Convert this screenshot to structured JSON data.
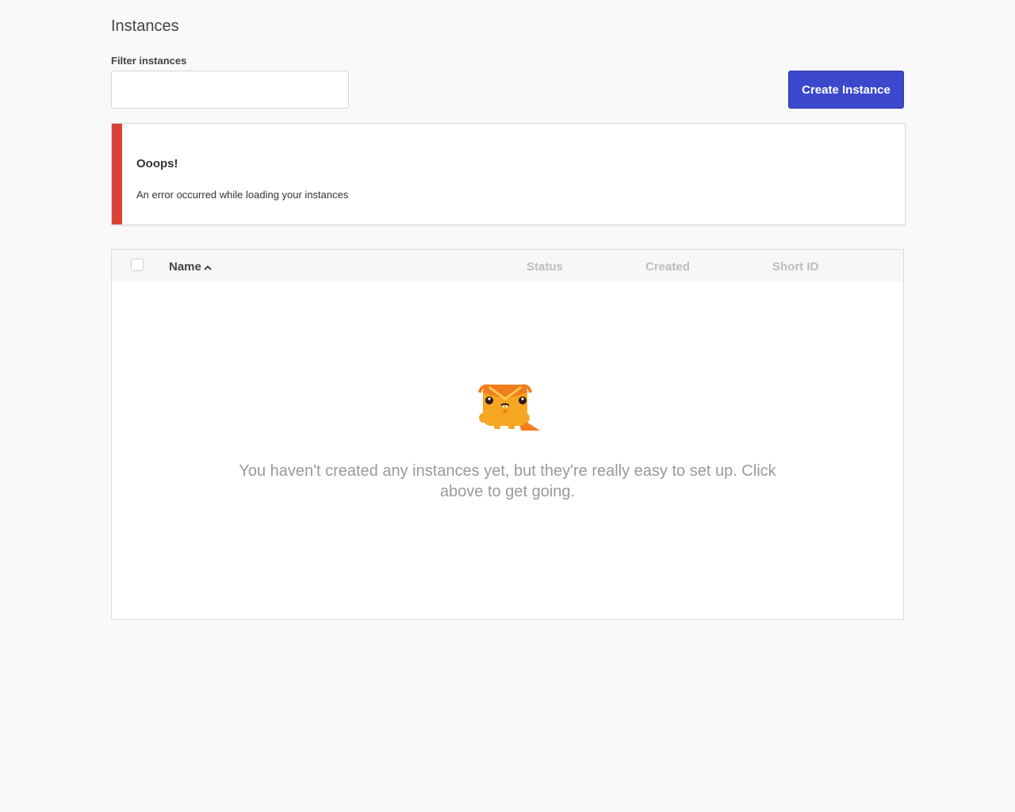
{
  "page": {
    "title": "Instances"
  },
  "filter": {
    "label": "Filter instances",
    "value": "",
    "placeholder": ""
  },
  "toolbar": {
    "create_label": "Create Instance"
  },
  "alert": {
    "title": "Ooops!",
    "message": "An error occurred while loading your instances",
    "accent_color": "#d94335"
  },
  "table": {
    "columns": [
      {
        "label": "Name",
        "sorted": "ascending"
      },
      {
        "label": "Status"
      },
      {
        "label": "Created"
      },
      {
        "label": "Short ID"
      }
    ],
    "rows": [],
    "empty_message": "You haven't created any instances yet, but they're really easy to set up. Click above to get going.",
    "empty_icon": "orange-mascot-icon"
  },
  "colors": {
    "primary": "#3b48cc",
    "error": "#d94335",
    "mascot": "#f5a623"
  }
}
